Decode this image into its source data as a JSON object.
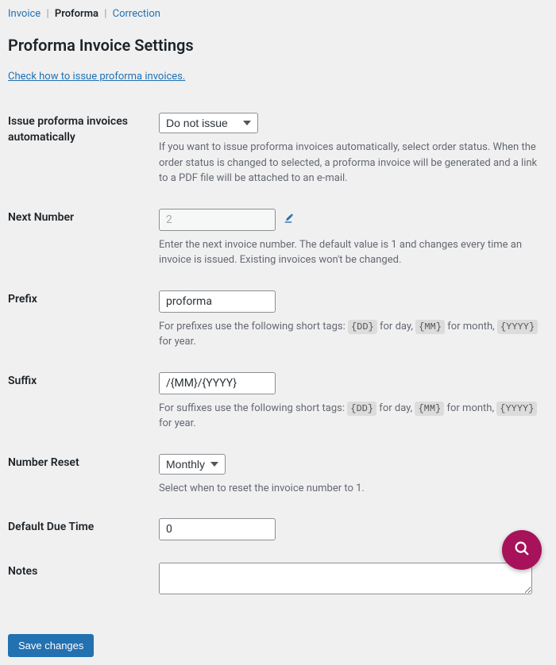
{
  "tabs": {
    "invoice": "Invoice",
    "proforma": "Proforma",
    "correction": "Correction"
  },
  "page_title": "Proforma Invoice Settings",
  "doc_link": "Check how to issue proforma invoices.",
  "fields": {
    "auto": {
      "label": "Issue proforma invoices automatically",
      "value": "Do not issue",
      "desc": "If you want to issue proforma invoices automatically, select order status. When the order status is changed to selected, a proforma invoice will be generated and a link to a PDF file will be attached to an e-mail."
    },
    "next_number": {
      "label": "Next Number",
      "value": "2",
      "desc": "Enter the next invoice number. The default value is 1 and changes every time an invoice is issued. Existing invoices won't be changed."
    },
    "prefix": {
      "label": "Prefix",
      "value": "proforma",
      "desc_pre": "For prefixes use the following short tags: ",
      "tag_dd": "{DD}",
      "for_day": " for day, ",
      "tag_mm": "{MM}",
      "for_month": " for month, ",
      "tag_yyyy": "{YYYY}",
      "for_year": " for year."
    },
    "suffix": {
      "label": "Suffix",
      "value": "/{MM}/{YYYY}",
      "desc_pre": "For suffixes use the following short tags: ",
      "tag_dd": "{DD}",
      "for_day": " for day, ",
      "tag_mm": "{MM}",
      "for_month": " for month, ",
      "tag_yyyy": "{YYYY}",
      "for_year": " for year."
    },
    "reset": {
      "label": "Number Reset",
      "value": "Monthly",
      "desc": "Select when to reset the invoice number to 1."
    },
    "due": {
      "label": "Default Due Time",
      "value": "0"
    },
    "notes": {
      "label": "Notes",
      "value": ""
    }
  },
  "save_button": "Save changes"
}
